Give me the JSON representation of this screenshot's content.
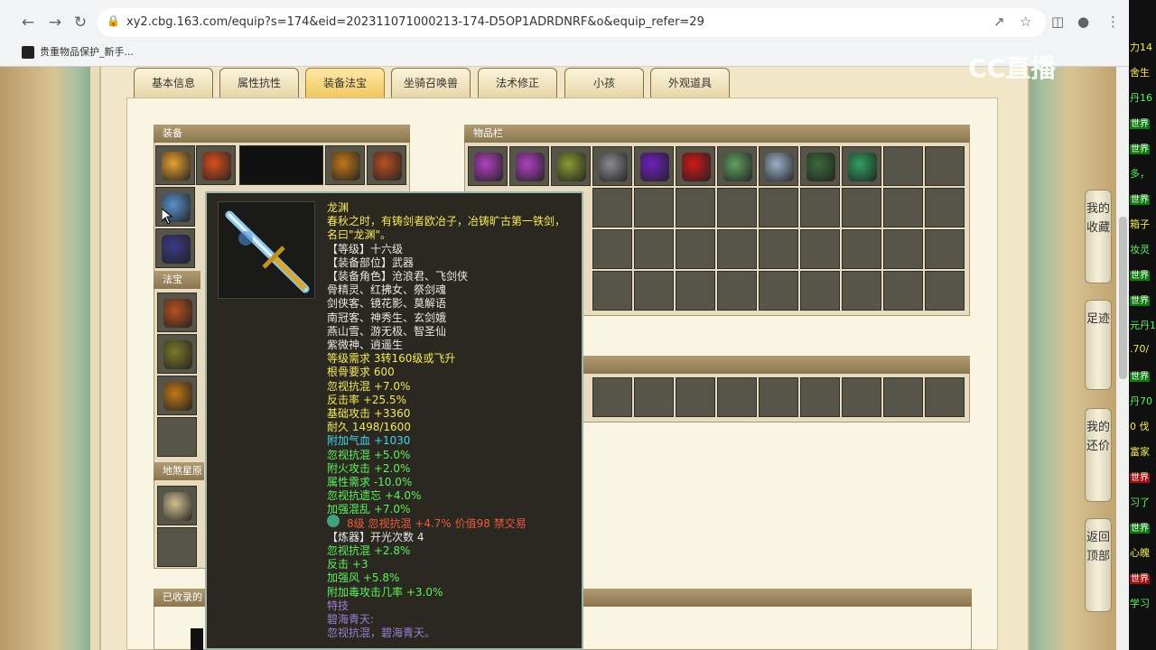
{
  "browser": {
    "url": "xy2.cbg.163.com/equip?s=174&eid=202311071000213-174-D5OP1ADRDNRF&o&equip_refer=29",
    "bookmark": "贵重物品保护_新手..."
  },
  "tabs": [
    {
      "label": "基本信息",
      "active": false
    },
    {
      "label": "属性抗性",
      "active": false
    },
    {
      "label": "装备法宝",
      "active": true
    },
    {
      "label": "坐骑召唤兽",
      "active": false
    },
    {
      "label": "法术修正",
      "active": false
    },
    {
      "label": "小孩",
      "active": false
    },
    {
      "label": "外观道具",
      "active": false
    }
  ],
  "sections": {
    "equipment": "装备",
    "inventory": "物品栏",
    "fabao": "法宝",
    "star": "地煞星原",
    "collected": "已收录的"
  },
  "equipment_icons": {
    "colors": [
      "#e8a030",
      "#d8501c",
      "#2a2a2a",
      "#c07818",
      "#b85020",
      "#5a90c8",
      "#3a3a8a",
      "#7a7a2a",
      "#d0c090"
    ]
  },
  "inventory_icons": {
    "colors": [
      "#b040c0",
      "#b040c0",
      "#8a9a30",
      "#8a8a90",
      "#7020c0",
      "#d01818",
      "#60a060",
      "#9ab0c8",
      "#3a6a3a",
      "#30a060"
    ]
  },
  "tooltip": {
    "lines": [
      {
        "text": "龙渊",
        "color": "y"
      },
      {
        "text": "春秋之时，有铸剑者欧冶子，冶铸旷古第一铁剑，",
        "color": "y"
      },
      {
        "text": "名曰\"龙渊\"。",
        "color": "y"
      },
      {
        "text": "【等级】十六级",
        "color": "w"
      },
      {
        "text": "【装备部位】武器",
        "color": "w"
      },
      {
        "text": "【装备角色】沧浪君、飞剑侠",
        "color": "w"
      },
      {
        "text": "骨精灵、红拂女、祭剑魂",
        "color": "w"
      },
      {
        "text": "剑侠客、镜花影、莫解语",
        "color": "w"
      },
      {
        "text": "南冠客、神秀生、玄剑娥",
        "color": "w"
      },
      {
        "text": "燕山雪、游无极、智圣仙",
        "color": "w"
      },
      {
        "text": "紫微神、逍遥生",
        "color": "w"
      },
      {
        "text": "等级需求 3转160级或飞升",
        "color": "y"
      },
      {
        "text": "根骨要求 600",
        "color": "y"
      },
      {
        "text": "忽视抗混 +7.0%",
        "color": "y"
      },
      {
        "text": "反击率 +25.5%",
        "color": "y"
      },
      {
        "text": "基础攻击 +3360",
        "color": "y"
      },
      {
        "text": "耐久 1498/1600",
        "color": "y"
      },
      {
        "text": "附加气血 +1030",
        "color": "c"
      },
      {
        "text": "忽视抗混 +5.0%",
        "color": "g"
      },
      {
        "text": "附火攻击 +2.0%",
        "color": "g"
      },
      {
        "text": "属性需求 -10.0%",
        "color": "g"
      },
      {
        "text": "忽视抗遗忘 +4.0%",
        "color": "g"
      },
      {
        "text": "加强混乱 +7.0%",
        "color": "g"
      },
      {
        "text": "8级 忽视抗混 +4.7% 价值98 禁交易",
        "color": "o"
      },
      {
        "text": " ",
        "color": "w"
      },
      {
        "text": "【炼器】开光次数 4",
        "color": "w"
      },
      {
        "text": "忽视抗混 +2.8%",
        "color": "g"
      },
      {
        "text": "反击 +3",
        "color": "g"
      },
      {
        "text": "加强风 +5.8%",
        "color": "g"
      },
      {
        "text": "附加毒攻击几率 +3.0%",
        "color": "g"
      },
      {
        "text": "特技",
        "color": "p"
      },
      {
        "text": "碧海青天:",
        "color": "p"
      },
      {
        "text": "忽视抗混，碧海青天。",
        "color": "p"
      }
    ]
  },
  "side_buttons": [
    {
      "label": "我的收藏"
    },
    {
      "label": "足迹"
    },
    {
      "label": "我的还价"
    },
    {
      "label": "返回顶部"
    }
  ],
  "chat": {
    "lines": [
      {
        "text": "力14",
        "color": "#f5e85c",
        "badge": ""
      },
      {
        "text": "舍生",
        "color": "#f5e85c",
        "badge": ""
      },
      {
        "text": "丹16",
        "color": "#5ef25e",
        "badge": ""
      },
      {
        "text": "世界",
        "color": "#fff",
        "badge": "g"
      },
      {
        "text": "世界",
        "color": "#fff",
        "badge": "g"
      },
      {
        "text": "多，",
        "color": "#5ef25e",
        "badge": ""
      },
      {
        "text": "世界",
        "color": "#fff",
        "badge": "g"
      },
      {
        "text": "箱子",
        "color": "#f5e85c",
        "badge": ""
      },
      {
        "text": "妆灵",
        "color": "#5ef25e",
        "badge": ""
      },
      {
        "text": "世界",
        "color": "#fff",
        "badge": "g"
      },
      {
        "text": "世界",
        "color": "#fff",
        "badge": "g"
      },
      {
        "text": "元丹1",
        "color": "#5ef25e",
        "badge": ""
      },
      {
        "text": ".70/",
        "color": "#f5e85c",
        "badge": ""
      },
      {
        "text": "世界",
        "color": "#fff",
        "badge": "g"
      },
      {
        "text": "丹70",
        "color": "#5ef25e",
        "badge": ""
      },
      {
        "text": "0 伐",
        "color": "#f5e85c",
        "badge": ""
      },
      {
        "text": "富家",
        "color": "#f5e85c",
        "badge": ""
      },
      {
        "text": "世界",
        "color": "#fff",
        "badge": "r"
      },
      {
        "text": "习了",
        "color": "#5ef25e",
        "badge": ""
      },
      {
        "text": "世界",
        "color": "#fff",
        "badge": "g"
      },
      {
        "text": "心魄",
        "color": "#f5e85c",
        "badge": ""
      },
      {
        "text": "世界",
        "color": "#fff",
        "badge": "r"
      },
      {
        "text": "学习",
        "color": "#5ef25e",
        "badge": ""
      }
    ]
  },
  "watermark": "CC直播"
}
